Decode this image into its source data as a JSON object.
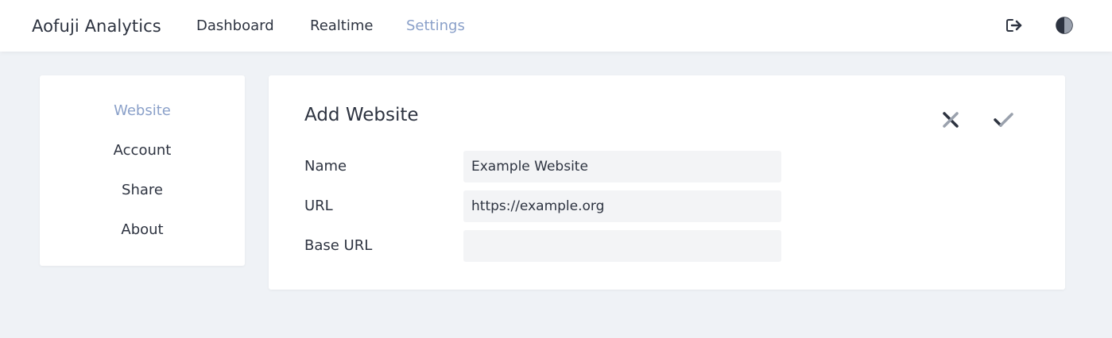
{
  "header": {
    "brand": "Aofuji Analytics",
    "nav": [
      {
        "label": "Dashboard",
        "active": false
      },
      {
        "label": "Realtime",
        "active": false
      },
      {
        "label": "Settings",
        "active": true
      }
    ],
    "icons": {
      "logout": "logout-icon",
      "theme": "half-circle-theme-icon"
    }
  },
  "sidebar": {
    "items": [
      {
        "label": "Website",
        "active": true
      },
      {
        "label": "Account",
        "active": false
      },
      {
        "label": "Share",
        "active": false
      },
      {
        "label": "About",
        "active": false
      }
    ]
  },
  "main": {
    "title": "Add Website",
    "actions": {
      "cancel_icon": "close-icon",
      "save_icon": "checkmark-icon"
    },
    "fields": [
      {
        "label": "Name",
        "value": "Example Website",
        "placeholder": ""
      },
      {
        "label": "URL",
        "value": "https://example.org",
        "placeholder": ""
      },
      {
        "label": "Base URL",
        "value": "",
        "placeholder": ""
      }
    ]
  },
  "colors": {
    "background": "#eff2f6",
    "surface": "#ffffff",
    "text": "#2d3340",
    "accent": "#8aa0c9",
    "input_bg": "#f3f4f6"
  }
}
